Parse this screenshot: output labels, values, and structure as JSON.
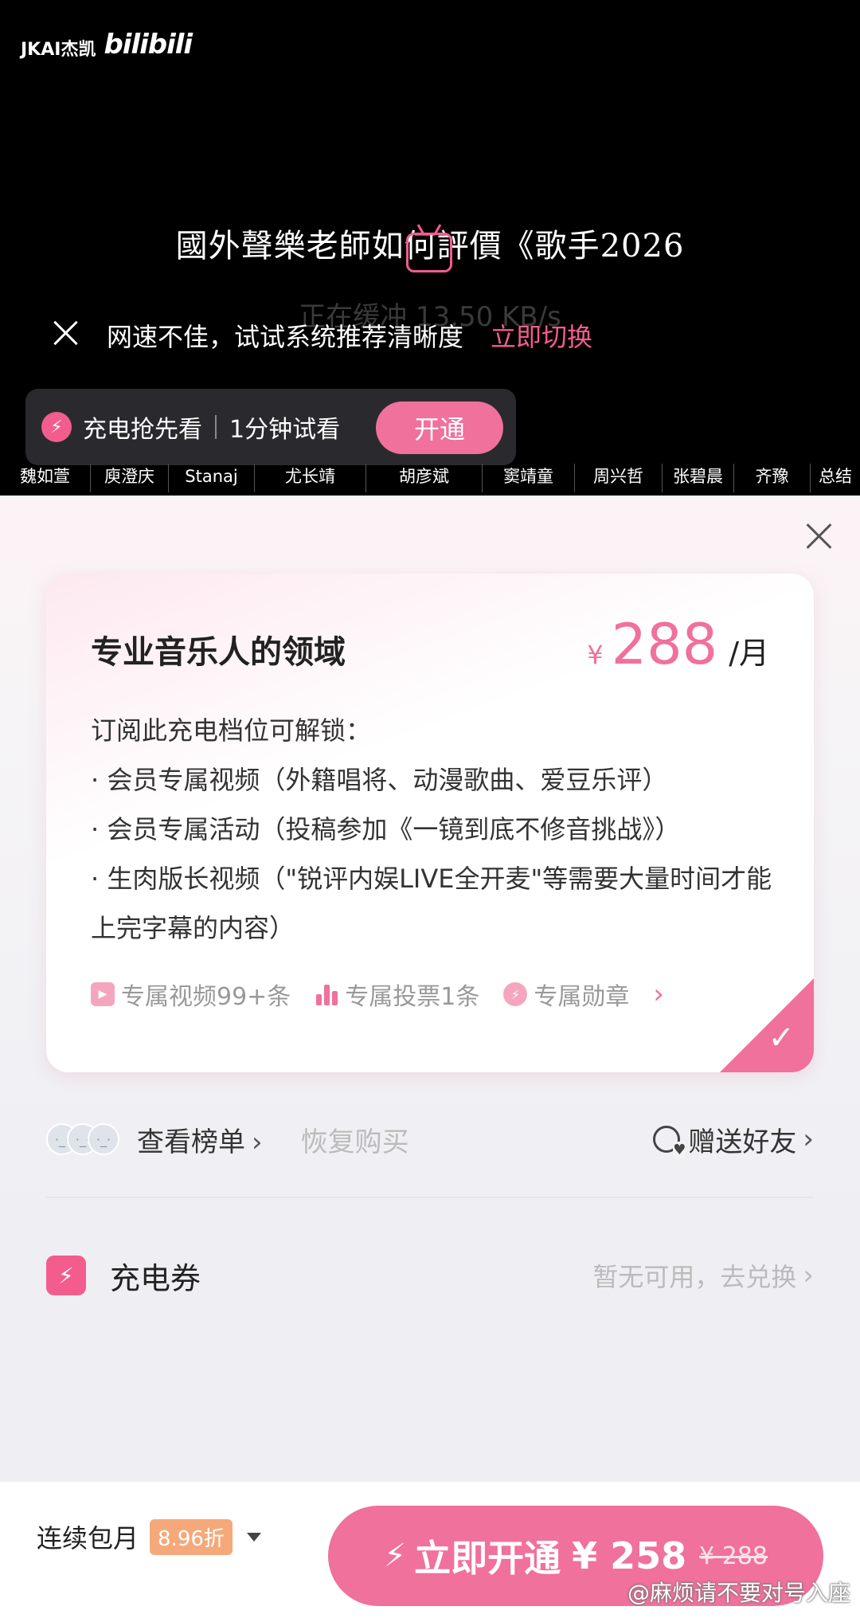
{
  "video": {
    "watermark_name": "JKAI杰凯",
    "watermark_logo": "bilibili",
    "title": "國外聲樂老師如何評價《歌手2026",
    "buffer_text": "正在缓冲  13.50 KB/s",
    "tip_text": "网速不佳，试试系统推荐清晰度",
    "tip_link": "立即切换",
    "charge_label": "充电抢先看",
    "trial_label": "1分钟试看",
    "open_button": "开通",
    "names": [
      "魏如萱",
      "庾澄庆",
      "Stanaj",
      "尤长靖",
      "胡彦斌",
      "窦靖童",
      "周兴哲",
      "张碧晨",
      "齐豫",
      "总结"
    ]
  },
  "tier": {
    "title": "专业音乐人的领域",
    "currency": "¥",
    "price": "288",
    "unit": "/月",
    "desc_heading": "订阅此充电档位可解锁：",
    "benefits": [
      "· 会员专属视频（外籍唱将、动漫歌曲、爱豆乐评）",
      "· 会员专属活动（投稿参加《一镜到底不修音挑战》）",
      "· 生肉版长视频（\"锐评内娱LIVE全开麦\"等需要大量时间才能上完字幕的内容）"
    ],
    "perks": [
      "专属视频99+条",
      "专属投票1条",
      "专属勋章"
    ]
  },
  "actions": {
    "leaderboard": "查看榜单",
    "restore": "恢复购买",
    "gift": "赠送好友"
  },
  "coupon": {
    "label": "充电券",
    "status": "暂无可用，去兑换"
  },
  "purchase": {
    "monthly": "连续包月",
    "discount": "8.96折",
    "buy_label": "立即开通",
    "buy_price": "¥ 258",
    "old_price": "¥ 288"
  },
  "weibo_watermark": "@麻烦请不要对号入座",
  "colors": {
    "accent": "#f0719b",
    "discount": "#f5a97b"
  }
}
